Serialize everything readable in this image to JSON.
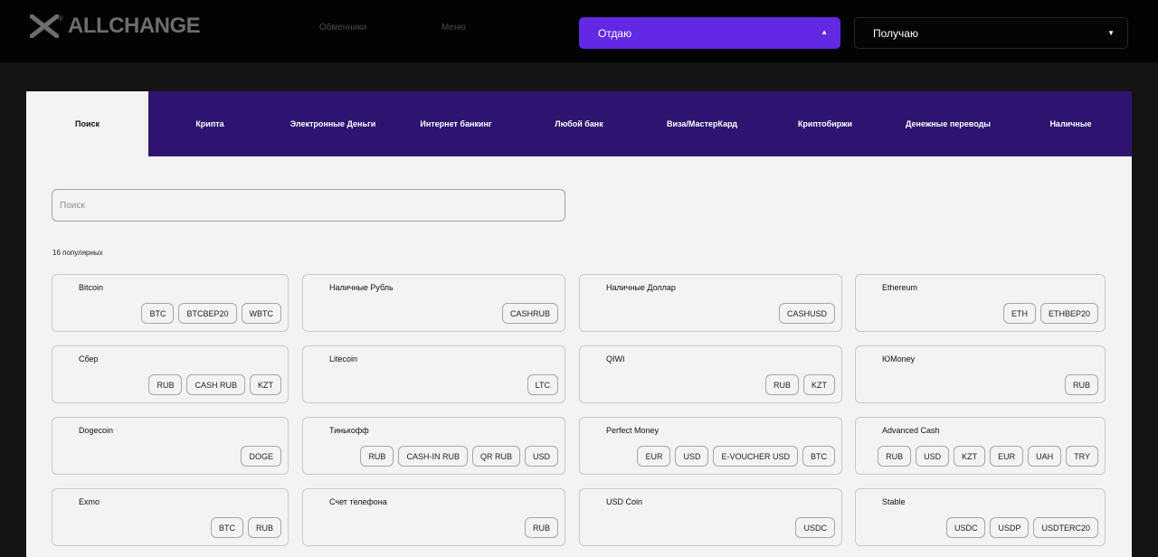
{
  "header": {
    "logo_text": "ALLCHANGE",
    "logo_mark": "®",
    "nav": [
      "Обменники",
      "Меню"
    ],
    "give_label": "Отдаю",
    "get_label": "Получаю"
  },
  "tabs": [
    "Поиск",
    "Крипта",
    "Электронные Деньги",
    "Интернет банкинг",
    "Любой банк",
    "Виза/МастерКард",
    "Криптобиржи",
    "Денежные переводы",
    "Наличные"
  ],
  "search": {
    "placeholder": "Поиск"
  },
  "popular_label": "16 популярных",
  "cards": [
    {
      "name": "Bitcoin",
      "tags": [
        "BTC",
        "BTCBEP20",
        "WBTC"
      ]
    },
    {
      "name": "Наличные Рубль",
      "tags": [
        "CASHRUB"
      ]
    },
    {
      "name": "Наличные Доллар",
      "tags": [
        "CASHUSD"
      ]
    },
    {
      "name": "Ethereum",
      "tags": [
        "ETH",
        "ETHBEP20"
      ]
    },
    {
      "name": "Сбер",
      "tags": [
        "RUB",
        "CASH RUB",
        "KZT"
      ]
    },
    {
      "name": "Litecoin",
      "tags": [
        "LTC"
      ]
    },
    {
      "name": "QIWI",
      "tags": [
        "RUB",
        "KZT"
      ]
    },
    {
      "name": "ЮMoney",
      "tags": [
        "RUB"
      ]
    },
    {
      "name": "Dogecoin",
      "tags": [
        "DOGE"
      ]
    },
    {
      "name": "Тинькофф",
      "tags": [
        "RUB",
        "CASH-IN RUB",
        "QR RUB",
        "USD"
      ]
    },
    {
      "name": "Perfect Money",
      "tags": [
        "EUR",
        "USD",
        "E-VOUCHER USD",
        "BTC"
      ]
    },
    {
      "name": "Advanced Cash",
      "tags": [
        "RUB",
        "USD",
        "KZT",
        "EUR",
        "UAH",
        "TRY"
      ]
    },
    {
      "name": "Exmo",
      "tags": [
        "BTC",
        "RUB"
      ]
    },
    {
      "name": "Счет телефона",
      "tags": [
        "RUB"
      ]
    },
    {
      "name": "USD Coin",
      "tags": [
        "USDC"
      ]
    },
    {
      "name": "Stable",
      "tags": [
        "USDC",
        "USDP",
        "USDTERC20"
      ]
    }
  ]
}
